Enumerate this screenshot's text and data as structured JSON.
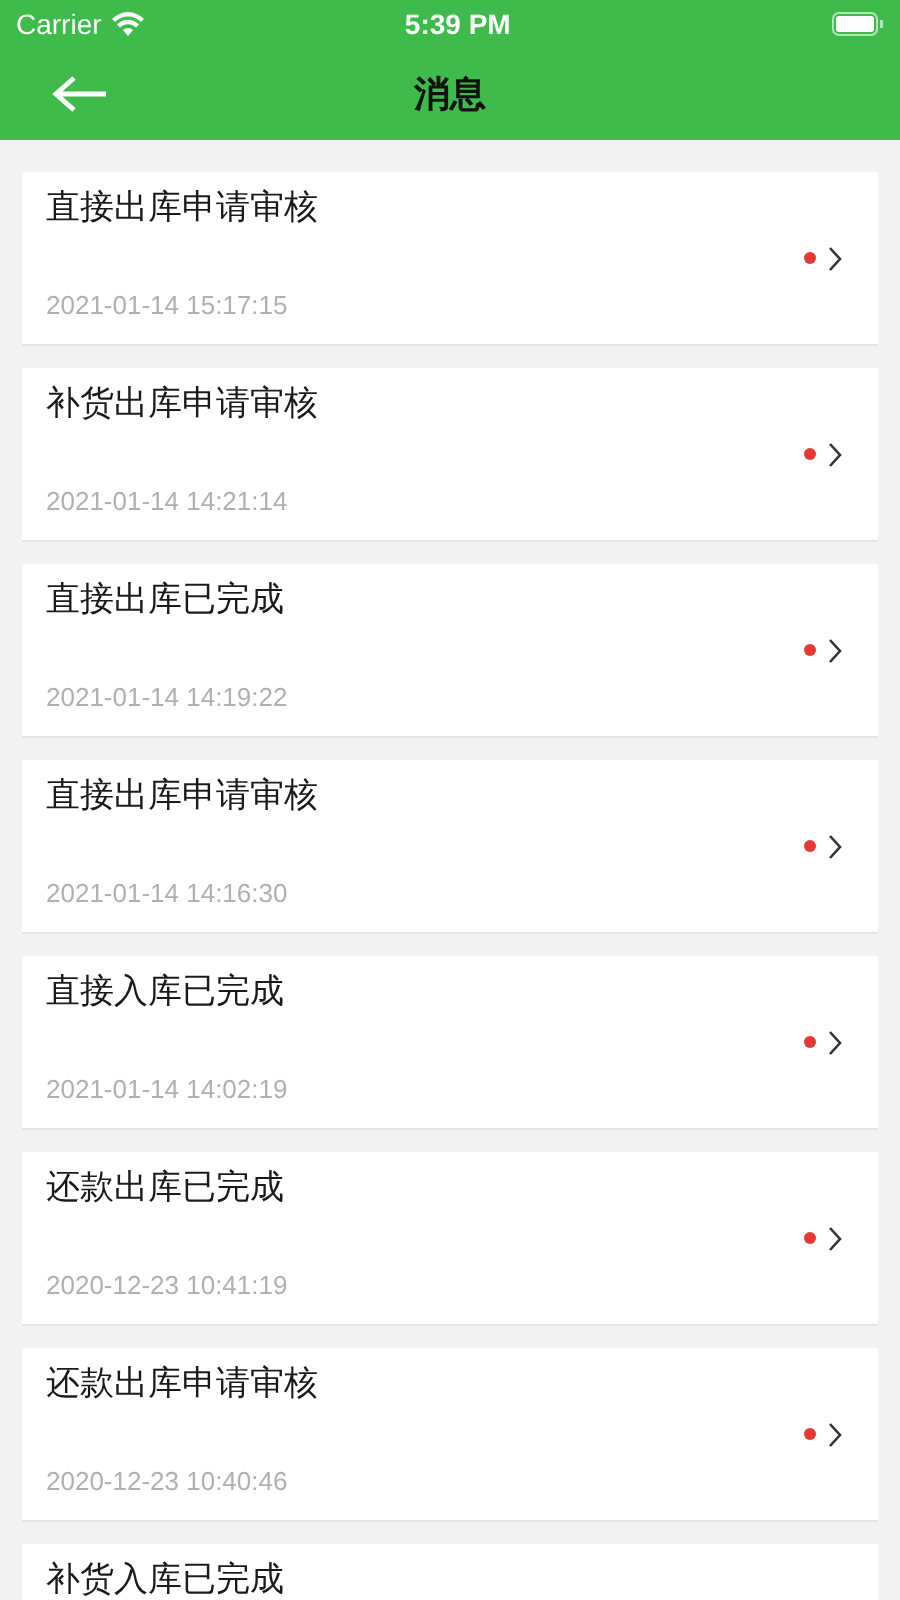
{
  "status_bar": {
    "carrier": "Carrier",
    "time": "5:39 PM"
  },
  "nav": {
    "title": "消息"
  },
  "messages": [
    {
      "title": "直接出库申请审核",
      "time": "2021-01-14 15:17:15",
      "unread": true
    },
    {
      "title": "补货出库申请审核",
      "time": "2021-01-14 14:21:14",
      "unread": true
    },
    {
      "title": "直接出库已完成",
      "time": "2021-01-14 14:19:22",
      "unread": true
    },
    {
      "title": "直接出库申请审核",
      "time": "2021-01-14 14:16:30",
      "unread": true
    },
    {
      "title": "直接入库已完成",
      "time": "2021-01-14 14:02:19",
      "unread": true
    },
    {
      "title": "还款出库已完成",
      "time": "2020-12-23 10:41:19",
      "unread": true
    },
    {
      "title": "还款出库申请审核",
      "time": "2020-12-23 10:40:46",
      "unread": true
    },
    {
      "title": "补货入库已完成"
    }
  ]
}
